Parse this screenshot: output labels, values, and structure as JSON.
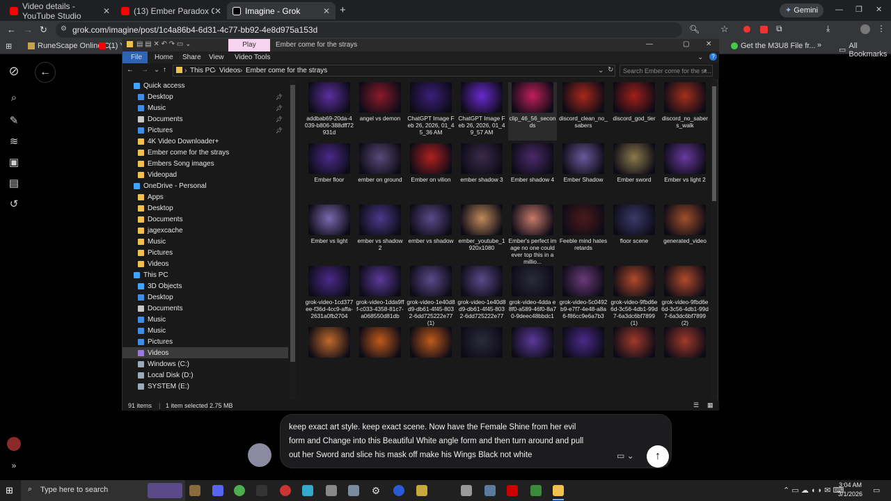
{
  "browser": {
    "tabs": [
      {
        "title": "Video details - YouTube Studio",
        "color": "#ff0000"
      },
      {
        "title": "(13) Ember Paradox Come for th",
        "color": "#ff0000"
      },
      {
        "title": "Imagine - Grok",
        "color": "#ffffff"
      }
    ],
    "new_tab": "+",
    "profile": "Gemini",
    "url": "grok.com/imagine/post/1c4a86b4-6d31-4c77-bb92-4e8d975a153d",
    "bookmarks": [
      "RuneScape Online C...",
      "(1) Yo"
    ],
    "right_bookmarks": [
      "Get the M3U8 File fr...",
      "All Bookmarks"
    ]
  },
  "explorer": {
    "title": "Ember come for the strays",
    "play_tab": "Play",
    "ribbon_tabs": [
      "File",
      "Home",
      "Share",
      "View",
      "Video Tools"
    ],
    "breadcrumb": [
      "This PC",
      "Videos",
      "Ember come for the strays"
    ],
    "search_placeholder": "Search Ember come for the st...",
    "nav": [
      {
        "label": "Quick access",
        "indent": 0,
        "color": "#3ea6ff",
        "pin": false
      },
      {
        "label": "Desktop",
        "indent": 1,
        "color": "#3c8ee8",
        "pin": true
      },
      {
        "label": "Music",
        "indent": 1,
        "color": "#3c8ee8",
        "pin": true
      },
      {
        "label": "Documents",
        "indent": 1,
        "color": "#c7c7c7",
        "pin": true
      },
      {
        "label": "Pictures",
        "indent": 1,
        "color": "#3c8ee8",
        "pin": true
      },
      {
        "label": "4K Video Downloader+",
        "indent": 1,
        "color": "#f0c24b",
        "pin": false
      },
      {
        "label": "Ember come for the strays",
        "indent": 1,
        "color": "#f0c24b",
        "pin": false
      },
      {
        "label": "Embers Song images",
        "indent": 1,
        "color": "#f0c24b",
        "pin": false
      },
      {
        "label": "Videopad",
        "indent": 1,
        "color": "#f0c24b",
        "pin": false
      },
      {
        "label": "OneDrive - Personal",
        "indent": 0,
        "color": "#3ea6ff",
        "pin": false
      },
      {
        "label": "Apps",
        "indent": 1,
        "color": "#f0c24b",
        "pin": false
      },
      {
        "label": "Desktop",
        "indent": 1,
        "color": "#f0c24b",
        "pin": false
      },
      {
        "label": "Documents",
        "indent": 1,
        "color": "#f0c24b",
        "pin": false
      },
      {
        "label": "jagexcache",
        "indent": 1,
        "color": "#f0c24b",
        "pin": false
      },
      {
        "label": "Music",
        "indent": 1,
        "color": "#f0c24b",
        "pin": false
      },
      {
        "label": "Pictures",
        "indent": 1,
        "color": "#f0c24b",
        "pin": false
      },
      {
        "label": "Videos",
        "indent": 1,
        "color": "#f0c24b",
        "pin": false
      },
      {
        "label": "This PC",
        "indent": 0,
        "color": "#3ea6ff",
        "pin": false
      },
      {
        "label": "3D Objects",
        "indent": 1,
        "color": "#3ea6ff",
        "pin": false
      },
      {
        "label": "Desktop",
        "indent": 1,
        "color": "#3c8ee8",
        "pin": false
      },
      {
        "label": "Documents",
        "indent": 1,
        "color": "#c7c7c7",
        "pin": false
      },
      {
        "label": "Music",
        "indent": 1,
        "color": "#3c8ee8",
        "pin": false
      },
      {
        "label": "Music",
        "indent": 1,
        "color": "#3c8ee8",
        "pin": false
      },
      {
        "label": "Pictures",
        "indent": 1,
        "color": "#3c8ee8",
        "pin": false
      },
      {
        "label": "Videos",
        "indent": 1,
        "color": "#9b7bd8",
        "pin": false,
        "selected": true
      },
      {
        "label": "Windows (C:)",
        "indent": 1,
        "color": "#9ab",
        "pin": false
      },
      {
        "label": "Local Disk (D:)",
        "indent": 1,
        "color": "#9ab",
        "pin": false
      },
      {
        "label": "SYSTEM (E:)",
        "indent": 1,
        "color": "#9ab",
        "pin": false
      }
    ],
    "files": [
      {
        "name": "addbab69-20da-4039-b806-388dff72931d",
        "color": "#5b2fa0"
      },
      {
        "name": "angel vs demon",
        "color": "#8b1a2a"
      },
      {
        "name": "ChatGPT Image Feb 26, 2026, 01_45_36 AM",
        "color": "#3b1f7a"
      },
      {
        "name": "ChatGPT Image Feb 26, 2026, 01_49_57 AM",
        "color": "#6a2ad0"
      },
      {
        "name": "clip_46_56_seconds",
        "color": "#c0205a",
        "selected": true
      },
      {
        "name": "discord_clean_no_sabers",
        "color": "#a8281a"
      },
      {
        "name": "discord_god_tier",
        "color": "#a02018"
      },
      {
        "name": "discord_no_sabers_walk",
        "color": "#a3301c"
      },
      {
        "name": "Ember floor",
        "color": "#4a2a8a"
      },
      {
        "name": "ember on ground",
        "color": "#5a4a7a"
      },
      {
        "name": "Ember on vilion",
        "color": "#b02020"
      },
      {
        "name": "ember shadow 3",
        "color": "#3a2a4a"
      },
      {
        "name": "Ember shadow 4",
        "color": "#4a2a6a"
      },
      {
        "name": "Ember Shadow",
        "color": "#6a5a9a"
      },
      {
        "name": "Ember sword",
        "color": "#8a7a4a"
      },
      {
        "name": "Ember vs light 2",
        "color": "#6a3aa0"
      },
      {
        "name": "Ember vs light",
        "color": "#7a6ab0"
      },
      {
        "name": "ember vs shadow 2",
        "color": "#4a3a8a"
      },
      {
        "name": "ember vs shadow",
        "color": "#5a4a8a"
      },
      {
        "name": "ember_youtube_1920x1080",
        "color": "#c08a5a"
      },
      {
        "name": "Ember's perfect image no one could ever top this in a millio...",
        "color": "#c87a6a"
      },
      {
        "name": "Feeble mind hates retards",
        "color": "#4a1a1a"
      },
      {
        "name": "floor scene",
        "color": "#3a3a6a"
      },
      {
        "name": "generated_video",
        "color": "#a0502a"
      },
      {
        "name": "grok-video-1cd377ee-f36d-4cc9-affa-2631a0fb2704",
        "color": "#4a2a8a"
      },
      {
        "name": "grok-video-1dda9fff-c033-4358-81c7-a068550d81db",
        "color": "#5a3a9a"
      },
      {
        "name": "grok-video-1e40d8d9-db61-4f45-8032-6dd725222e77 (1)",
        "color": "#5a4a8a"
      },
      {
        "name": "grok-video-1e40d8d9-db61-4f45-8032-6dd725222e77",
        "color": "#5a4a8a"
      },
      {
        "name": "grok-video-4dda e8f0-a589-46f0-8a70-9deec48bbdc1",
        "color": "#2a2a3a"
      },
      {
        "name": "grok-video-5c0492b9-e7f7-4e48-a8a6-f86cc9e6a7b3",
        "color": "#6a3a7a"
      },
      {
        "name": "grok-video-9fbd6e6d-3c56-4db1-99d7-6a3dc6bf7899 (1)",
        "color": "#b04a2a"
      },
      {
        "name": "grok-video-9fbd6e6d-3c56-4db1-99d7-6a3dc6bf7899 (2)",
        "color": "#b04a2a"
      },
      {
        "name": "",
        "color": "#c06a2a"
      },
      {
        "name": "",
        "color": "#c05a1a"
      },
      {
        "name": "",
        "color": "#c05a1a"
      },
      {
        "name": "",
        "color": "#2a2a3a"
      },
      {
        "name": "",
        "color": "#5a3a9a"
      },
      {
        "name": "",
        "color": "#4a2a8a"
      },
      {
        "name": "",
        "color": "#a03a2a"
      },
      {
        "name": "",
        "color": "#a03a2a"
      }
    ],
    "status": {
      "count": "91 items",
      "selected": "1 item selected 2.75 MB"
    }
  },
  "prompt": {
    "text": "keep exact art style. keep exact scene. Now have the Female Shine from her evil form and Change into this Beautiful White angle form and then turn around and pull out her Sword and slice his mask off make his Wings Black not white"
  },
  "taskbar": {
    "search_placeholder": "Type here to search",
    "time": "3:04 AM",
    "date": "3/1/2026"
  }
}
